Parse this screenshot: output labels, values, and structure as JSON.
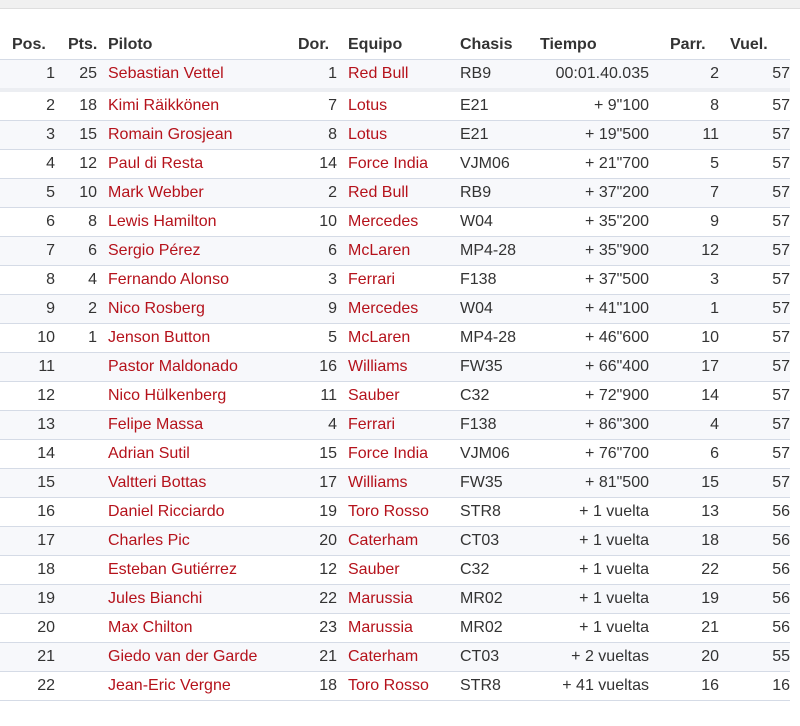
{
  "headers": {
    "pos": "Pos.",
    "pts": "Pts.",
    "piloto": "Piloto",
    "dor": "Dor.",
    "equipo": "Equipo",
    "chasis": "Chasis",
    "tiempo": "Tiempo",
    "parr": "Parr.",
    "vuel": "Vuel."
  },
  "colors": {
    "link": "#b5121b",
    "text": "#333333",
    "row_alt": "#f7f8fb",
    "border": "#d5dbe6"
  },
  "rows": [
    {
      "pos": "1",
      "pts": "25",
      "piloto": "Sebastian Vettel",
      "dor": "1",
      "equipo": "Red Bull",
      "chasis": "RB9",
      "tiempo": "00:01.40.035",
      "parr": "2",
      "vuel": "57"
    },
    {
      "pos": "2",
      "pts": "18",
      "piloto": "Kimi Räikkönen",
      "dor": "7",
      "equipo": "Lotus",
      "chasis": "E21",
      "tiempo": "+ 9\"100",
      "parr": "8",
      "vuel": "57"
    },
    {
      "pos": "3",
      "pts": "15",
      "piloto": "Romain Grosjean",
      "dor": "8",
      "equipo": "Lotus",
      "chasis": "E21",
      "tiempo": "+ 19\"500",
      "parr": "11",
      "vuel": "57"
    },
    {
      "pos": "4",
      "pts": "12",
      "piloto": "Paul di Resta",
      "dor": "14",
      "equipo": "Force India",
      "chasis": "VJM06",
      "tiempo": "+ 21\"700",
      "parr": "5",
      "vuel": "57"
    },
    {
      "pos": "5",
      "pts": "10",
      "piloto": "Mark Webber",
      "dor": "2",
      "equipo": "Red Bull",
      "chasis": "RB9",
      "tiempo": "+ 37\"200",
      "parr": "7",
      "vuel": "57"
    },
    {
      "pos": "6",
      "pts": "8",
      "piloto": "Lewis Hamilton",
      "dor": "10",
      "equipo": "Mercedes",
      "chasis": "W04",
      "tiempo": "+ 35\"200",
      "parr": "9",
      "vuel": "57"
    },
    {
      "pos": "7",
      "pts": "6",
      "piloto": "Sergio Pérez",
      "dor": "6",
      "equipo": "McLaren",
      "chasis": "MP4-28",
      "tiempo": "+ 35\"900",
      "parr": "12",
      "vuel": "57"
    },
    {
      "pos": "8",
      "pts": "4",
      "piloto": "Fernando Alonso",
      "dor": "3",
      "equipo": "Ferrari",
      "chasis": "F138",
      "tiempo": "+ 37\"500",
      "parr": "3",
      "vuel": "57"
    },
    {
      "pos": "9",
      "pts": "2",
      "piloto": "Nico Rosberg",
      "dor": "9",
      "equipo": "Mercedes",
      "chasis": "W04",
      "tiempo": "+ 41\"100",
      "parr": "1",
      "vuel": "57"
    },
    {
      "pos": "10",
      "pts": "1",
      "piloto": "Jenson Button",
      "dor": "5",
      "equipo": "McLaren",
      "chasis": "MP4-28",
      "tiempo": "+ 46\"600",
      "parr": "10",
      "vuel": "57"
    },
    {
      "pos": "11",
      "pts": "",
      "piloto": "Pastor Maldonado",
      "dor": "16",
      "equipo": "Williams",
      "chasis": "FW35",
      "tiempo": "+ 66\"400",
      "parr": "17",
      "vuel": "57"
    },
    {
      "pos": "12",
      "pts": "",
      "piloto": "Nico Hülkenberg",
      "dor": "11",
      "equipo": "Sauber",
      "chasis": "C32",
      "tiempo": "+ 72\"900",
      "parr": "14",
      "vuel": "57"
    },
    {
      "pos": "13",
      "pts": "",
      "piloto": "Felipe Massa",
      "dor": "4",
      "equipo": "Ferrari",
      "chasis": "F138",
      "tiempo": "+ 86\"300",
      "parr": "4",
      "vuel": "57"
    },
    {
      "pos": "14",
      "pts": "",
      "piloto": "Adrian Sutil",
      "dor": "15",
      "equipo": "Force India",
      "chasis": "VJM06",
      "tiempo": "+ 76\"700",
      "parr": "6",
      "vuel": "57"
    },
    {
      "pos": "15",
      "pts": "",
      "piloto": "Valtteri Bottas",
      "dor": "17",
      "equipo": "Williams",
      "chasis": "FW35",
      "tiempo": "+ 81\"500",
      "parr": "15",
      "vuel": "57"
    },
    {
      "pos": "16",
      "pts": "",
      "piloto": "Daniel Ricciardo",
      "dor": "19",
      "equipo": "Toro Rosso",
      "chasis": "STR8",
      "tiempo": "+ 1 vuelta",
      "parr": "13",
      "vuel": "56"
    },
    {
      "pos": "17",
      "pts": "",
      "piloto": "Charles Pic",
      "dor": "20",
      "equipo": "Caterham",
      "chasis": "CT03",
      "tiempo": "+ 1 vuelta",
      "parr": "18",
      "vuel": "56"
    },
    {
      "pos": "18",
      "pts": "",
      "piloto": "Esteban Gutiérrez",
      "dor": "12",
      "equipo": "Sauber",
      "chasis": "C32",
      "tiempo": "+ 1 vuelta",
      "parr": "22",
      "vuel": "56"
    },
    {
      "pos": "19",
      "pts": "",
      "piloto": "Jules Bianchi",
      "dor": "22",
      "equipo": "Marussia",
      "chasis": "MR02",
      "tiempo": "+ 1 vuelta",
      "parr": "19",
      "vuel": "56"
    },
    {
      "pos": "20",
      "pts": "",
      "piloto": "Max Chilton",
      "dor": "23",
      "equipo": "Marussia",
      "chasis": "MR02",
      "tiempo": "+ 1 vuelta",
      "parr": "21",
      "vuel": "56"
    },
    {
      "pos": "21",
      "pts": "",
      "piloto": "Giedo van der Garde",
      "dor": "21",
      "equipo": "Caterham",
      "chasis": "CT03",
      "tiempo": "+ 2 vueltas",
      "parr": "20",
      "vuel": "55"
    },
    {
      "pos": "22",
      "pts": "",
      "piloto": "Jean-Eric Vergne",
      "dor": "18",
      "equipo": "Toro Rosso",
      "chasis": "STR8",
      "tiempo": "+ 41 vueltas",
      "parr": "16",
      "vuel": "16"
    }
  ]
}
